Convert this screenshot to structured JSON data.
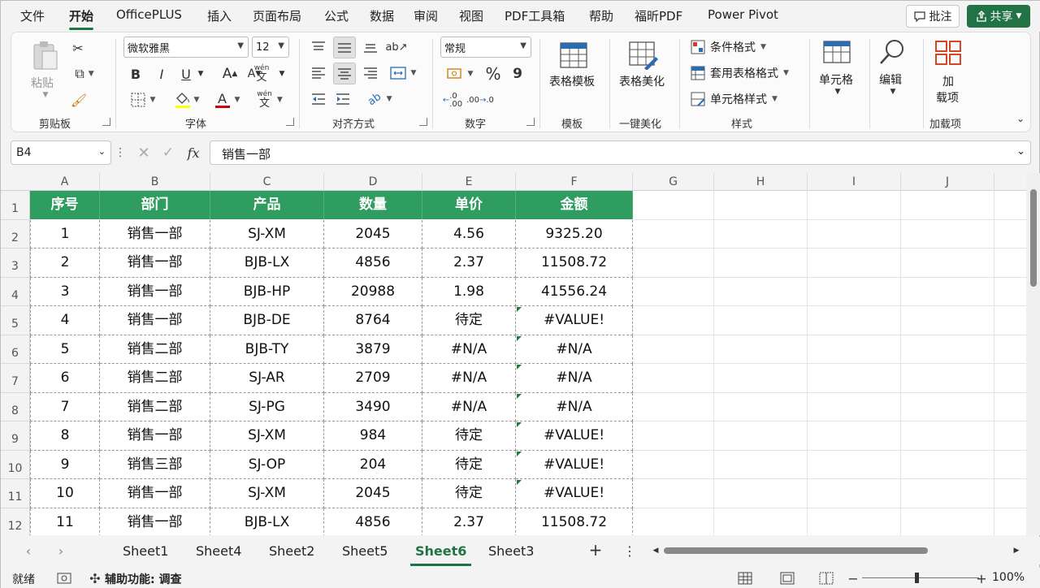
{
  "menu": {
    "tabs": [
      "文件",
      "开始",
      "OfficePLUS",
      "插入",
      "页面布局",
      "公式",
      "数据",
      "审阅",
      "视图",
      "PDF工具箱",
      "帮助",
      "福昕PDF",
      "Power Pivot"
    ],
    "active": "开始",
    "comment": "批注",
    "share": "共享"
  },
  "ribbon": {
    "clipboard": {
      "label": "剪贴板",
      "paste": "粘贴"
    },
    "font": {
      "label": "字体",
      "name": "微软雅黑",
      "size": "12",
      "bold": "B",
      "italic": "I",
      "underline": "U",
      "grow": "A",
      "shrink": "A",
      "phonetic_top": "wén",
      "phonetic": "文",
      "color_letter": "A"
    },
    "align": {
      "label": "对齐方式"
    },
    "number": {
      "label": "数字",
      "format": "常规",
      "percent": "%",
      "comma": "9"
    },
    "templates": {
      "label": "模板",
      "table_template": "表格模板"
    },
    "beautify": {
      "label": "一键美化",
      "beautify_btn": "表格美化"
    },
    "styles": {
      "label": "样式",
      "conditional": "条件格式",
      "table_format": "套用表格格式",
      "cell_style": "单元格样式"
    },
    "cells": {
      "label": "单元格"
    },
    "edit": {
      "label": "编辑"
    },
    "addins": {
      "label": "加载项",
      "btn_line1": "加",
      "btn_line2": "载项"
    }
  },
  "formula_bar": {
    "name_box": "B4",
    "fx": "fx",
    "value": "销售一部"
  },
  "sheet": {
    "columns": [
      "A",
      "B",
      "C",
      "D",
      "E",
      "F",
      "G",
      "H",
      "I",
      "J"
    ],
    "rows": [
      "1",
      "2",
      "3",
      "4",
      "5",
      "6",
      "7",
      "8",
      "9",
      "10",
      "11",
      "12"
    ],
    "headers": [
      "序号",
      "部门",
      "产品",
      "数量",
      "单价",
      "金额"
    ],
    "data": [
      [
        "1",
        "销售一部",
        "SJ-XM",
        "2045",
        "4.56",
        "9325.20"
      ],
      [
        "2",
        "销售一部",
        "BJB-LX",
        "4856",
        "2.37",
        "11508.72"
      ],
      [
        "3",
        "销售一部",
        "BJB-HP",
        "20988",
        "1.98",
        "41556.24"
      ],
      [
        "4",
        "销售一部",
        "BJB-DE",
        "8764",
        "待定",
        "#VALUE!"
      ],
      [
        "5",
        "销售二部",
        "BJB-TY",
        "3879",
        "#N/A",
        "#N/A"
      ],
      [
        "6",
        "销售二部",
        "SJ-AR",
        "2709",
        "#N/A",
        "#N/A"
      ],
      [
        "7",
        "销售二部",
        "SJ-PG",
        "3490",
        "#N/A",
        "#N/A"
      ],
      [
        "8",
        "销售一部",
        "SJ-XM",
        "984",
        "待定",
        "#VALUE!"
      ],
      [
        "9",
        "销售三部",
        "SJ-OP",
        "204",
        "待定",
        "#VALUE!"
      ],
      [
        "10",
        "销售一部",
        "SJ-XM",
        "2045",
        "待定",
        "#VALUE!"
      ],
      [
        "11",
        "销售一部",
        "BJB-LX",
        "4856",
        "2.37",
        "11508.72"
      ]
    ],
    "header_color": "#2f9d5f"
  },
  "sheet_tabs": {
    "tabs": [
      "Sheet1",
      "Sheet4",
      "Sheet2",
      "Sheet5",
      "Sheet6",
      "Sheet3"
    ],
    "active": "Sheet6"
  },
  "status": {
    "ready": "就绪",
    "accessibility": "辅助功能: 调查",
    "zoom": "100%"
  }
}
